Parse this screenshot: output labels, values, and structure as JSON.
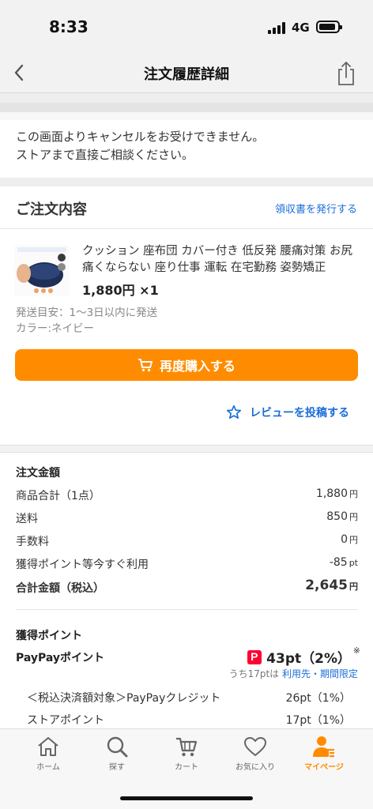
{
  "status_bar": {
    "time": "8:33",
    "network": "4G"
  },
  "nav": {
    "title": "注文履歴詳細"
  },
  "notice": {
    "line1": "この画面よりキャンセルをお受けできません。",
    "line2": "ストアまで直接ご相談ください。"
  },
  "order": {
    "title": "ご注文内容",
    "receipt_link": "領収書を発行する",
    "product": {
      "name": "クッション 座布団 カバー付き 低反発 腰痛対策 お尻痛くならない 座り仕事 運転 在宅勤務 姿勢矯正",
      "price": "1,880円 ×1",
      "shipping": "発送目安：1〜3日以内に発送",
      "color": "カラー:ネイビー"
    },
    "buy_again_label": "再度購入する",
    "review_label": "レビューを投稿する"
  },
  "amounts": {
    "title": "注文金額",
    "rows": [
      {
        "label": "商品合計（1点）",
        "value": "1,880",
        "unit": "円"
      },
      {
        "label": "送料",
        "value": "850",
        "unit": "円"
      },
      {
        "label": "手数料",
        "value": "0",
        "unit": "円"
      },
      {
        "label": "獲得ポイント等今すぐ利用",
        "value": "-85",
        "unit": "pt"
      }
    ],
    "total": {
      "label": "合計金額（税込）",
      "value": "2,645",
      "unit": "円"
    }
  },
  "points": {
    "title": "獲得ポイント",
    "paypay_label": "PayPayポイント",
    "paypay_value": "43pt（2%）",
    "paypay_mark": "※",
    "sub_prefix": "うち17ptは",
    "sub_link": "利用先・期間限定",
    "rows": [
      {
        "label": "＜税込決済額対象＞PayPayクレジット",
        "value": "26pt（1%）"
      },
      {
        "label": "ストアポイント",
        "value": "17pt（1%）"
      }
    ]
  },
  "tabs": [
    {
      "label": "ホーム",
      "icon": "home-icon"
    },
    {
      "label": "探す",
      "icon": "search-icon"
    },
    {
      "label": "カート",
      "icon": "cart-icon"
    },
    {
      "label": "お気に入り",
      "icon": "heart-icon"
    },
    {
      "label": "マイページ",
      "icon": "user-icon",
      "active": true
    }
  ],
  "colors": {
    "accent": "#ff8c00",
    "link": "#1a6ed8",
    "paypay": "#ff0033"
  }
}
